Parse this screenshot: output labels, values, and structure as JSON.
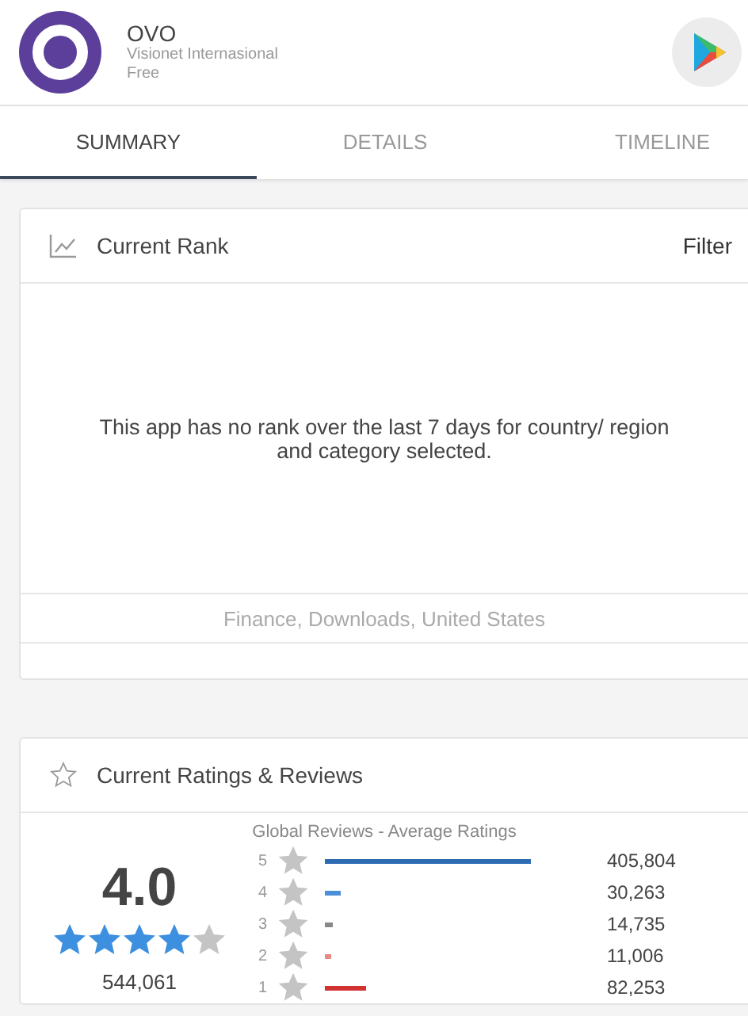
{
  "app": {
    "name": "OVO",
    "developer": "Visionet Internasional",
    "price": "Free"
  },
  "tabs": [
    {
      "label": "SUMMARY",
      "selected": true
    },
    {
      "label": "DETAILS",
      "selected": false
    },
    {
      "label": "TIMELINE",
      "selected": false
    }
  ],
  "rank_card": {
    "title": "Current Rank",
    "filter": "Filter",
    "message": "This app has no rank over the last 7 days for country/ region and category selected.",
    "footer": "Finance, Downloads, United States"
  },
  "ratings_card": {
    "title": "Current Ratings & Reviews",
    "subtitle": "Global Reviews - Average Ratings",
    "average": "4.0",
    "stars": 4,
    "total": "544,061",
    "rows": [
      {
        "label": "5",
        "color": "#2e6db4",
        "count": "405,804"
      },
      {
        "label": "4",
        "color": "#4a90d9",
        "count": "30,263"
      },
      {
        "label": "3",
        "color": "#888888",
        "count": "14,735"
      },
      {
        "label": "2",
        "color": "#e88a8a",
        "count": "11,006"
      },
      {
        "label": "1",
        "color": "#d23232",
        "count": "82,253"
      }
    ]
  }
}
